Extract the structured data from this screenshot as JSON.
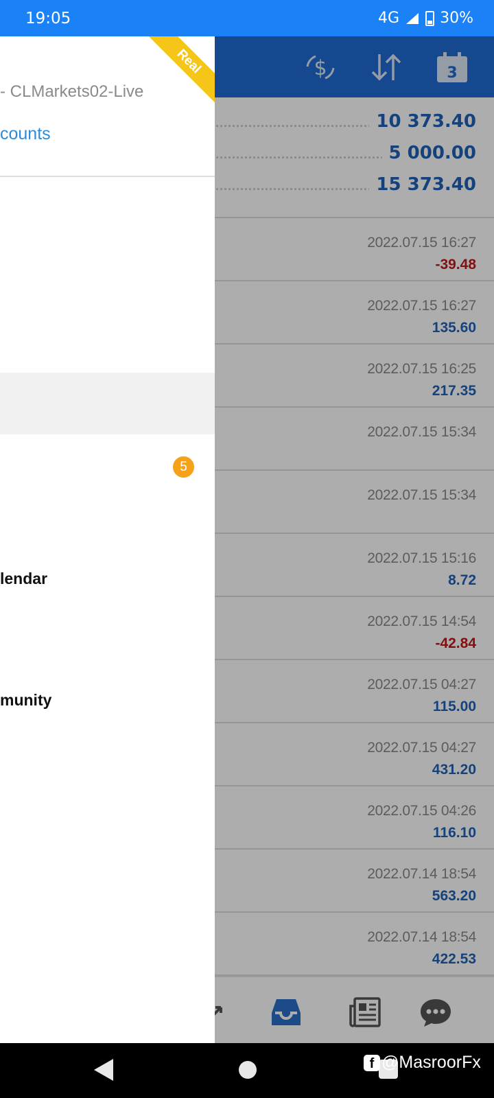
{
  "status_bar": {
    "time": "19:05",
    "network": "4G",
    "battery": "30%"
  },
  "toolbar": {
    "icons": [
      "currency-exchange-icon",
      "sort-icon",
      "calendar-icon"
    ],
    "calendar_day": "3"
  },
  "summary": [
    {
      "value": "10 373.40"
    },
    {
      "value": "5 000.00"
    },
    {
      "value": "15 373.40"
    }
  ],
  "deals": [
    {
      "time": "2022.07.15 16:27",
      "profit": "-39.48",
      "negative": true
    },
    {
      "time": "2022.07.15 16:27",
      "profit": "135.60",
      "negative": false
    },
    {
      "time": "2022.07.15 16:25",
      "profit": "217.35",
      "negative": false
    },
    {
      "time": "2022.07.15 15:34",
      "profit": "",
      "negative": false
    },
    {
      "time": "2022.07.15 15:34",
      "profit": "",
      "negative": false
    },
    {
      "time": "2022.07.15 15:16",
      "profit": "8.72",
      "negative": false
    },
    {
      "time": "2022.07.15 14:54",
      "profit": "-42.84",
      "negative": true
    },
    {
      "time": "2022.07.15 04:27",
      "profit": "115.00",
      "negative": false
    },
    {
      "time": "2022.07.15 04:27",
      "profit": "431.20",
      "negative": false
    },
    {
      "time": "2022.07.15 04:26",
      "profit": "116.10",
      "negative": false
    },
    {
      "time": "2022.07.14 18:54",
      "profit": "563.20",
      "negative": false
    },
    {
      "time": "2022.07.14 18:54",
      "profit": "422.53",
      "negative": false
    }
  ],
  "drawer": {
    "ribbon": "Real",
    "server": "- CLMarkets02-Live",
    "accounts_link": "counts",
    "badge": "5",
    "items": {
      "calendar": "lendar",
      "community": "munity"
    }
  },
  "watermark": "@MasroorFx",
  "colors": {
    "accent": "#1f6ad2",
    "status_bar": "#1a82f6",
    "ribbon": "#f5c518",
    "badge": "#f5a21a",
    "negative": "#c01818",
    "positive": "#1f62b7"
  }
}
